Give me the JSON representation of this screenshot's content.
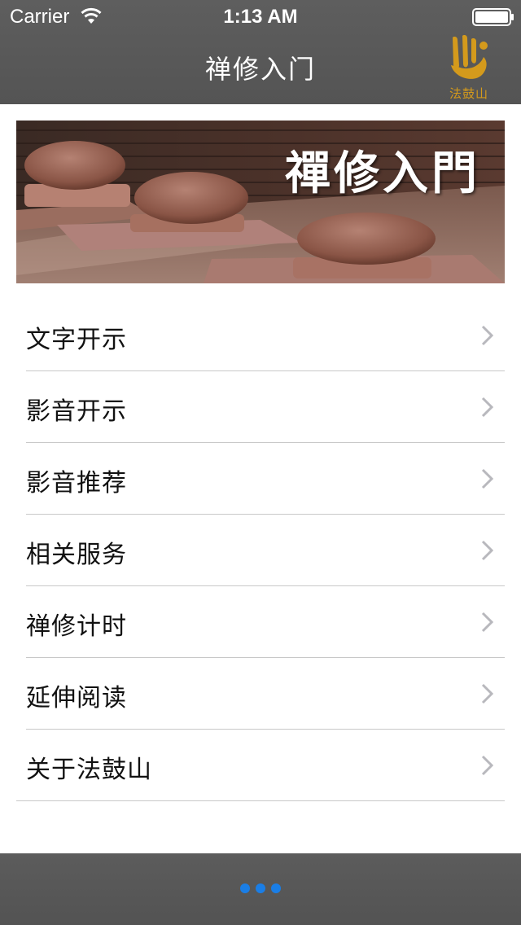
{
  "status_bar": {
    "carrier": "Carrier",
    "time": "1:13 AM"
  },
  "nav_bar": {
    "title": "禅修入门",
    "logo_text": "法鼓山",
    "logo_color": "#d49a1c"
  },
  "banner": {
    "title": "禪修入門"
  },
  "menu": {
    "items": [
      {
        "label": "文字开示"
      },
      {
        "label": "影音开示"
      },
      {
        "label": "影音推荐"
      },
      {
        "label": "相关服务"
      },
      {
        "label": "禅修计时"
      },
      {
        "label": "延伸阅读"
      },
      {
        "label": "关于法鼓山"
      }
    ]
  },
  "bottom_bar": {
    "dot_color": "#1a7ee6",
    "dots": 3
  },
  "icons": [
    "wifi-icon",
    "battery-icon",
    "logo-mark",
    "chevron-right-icon"
  ]
}
